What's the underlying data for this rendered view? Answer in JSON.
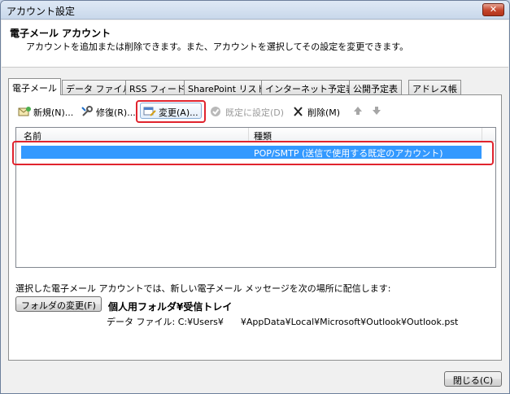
{
  "window": {
    "title": "アカウント設定",
    "close_label": "✕"
  },
  "header": {
    "title": "電子メール アカウント",
    "description": "アカウントを追加または削除できます。また、アカウントを選択してその設定を変更できます。"
  },
  "tabs": [
    {
      "label": "電子メール",
      "active": true
    },
    {
      "label": "データ ファイル",
      "active": false
    },
    {
      "label": "RSS フィード",
      "active": false
    },
    {
      "label": "SharePoint リスト",
      "active": false
    },
    {
      "label": "インターネット予定表",
      "active": false
    },
    {
      "label": "公開予定表",
      "active": false
    },
    {
      "label": "アドレス帳",
      "active": false
    }
  ],
  "toolbar": {
    "new_label": "新規(N)...",
    "repair_label": "修復(R)...",
    "change_label": "変更(A)...",
    "set_default_label": "既定に設定(D)",
    "delete_label": "削除(M)",
    "up_icon": "arrow-up-icon",
    "down_icon": "arrow-down-icon"
  },
  "account_list": {
    "columns": [
      "名前",
      "種類"
    ],
    "rows": [
      {
        "name": "",
        "type": "POP/SMTP (送信で使用する既定のアカウント)",
        "selected": true
      }
    ]
  },
  "delivery": {
    "text": "選択した電子メール アカウントでは、新しい電子メール メッセージを次の場所に配信します:",
    "change_folder_label": "フォルダの変更(F)",
    "folder_name": "個人用フォルダ¥受信トレイ",
    "data_file": "データ ファイル: C:¥Users¥      ¥AppData¥Local¥Microsoft¥Outlook¥Outlook.pst"
  },
  "footer": {
    "close_label": "閉じる(C)"
  },
  "colors": {
    "selection": "#3399ff",
    "highlight_border": "#e0242e"
  }
}
